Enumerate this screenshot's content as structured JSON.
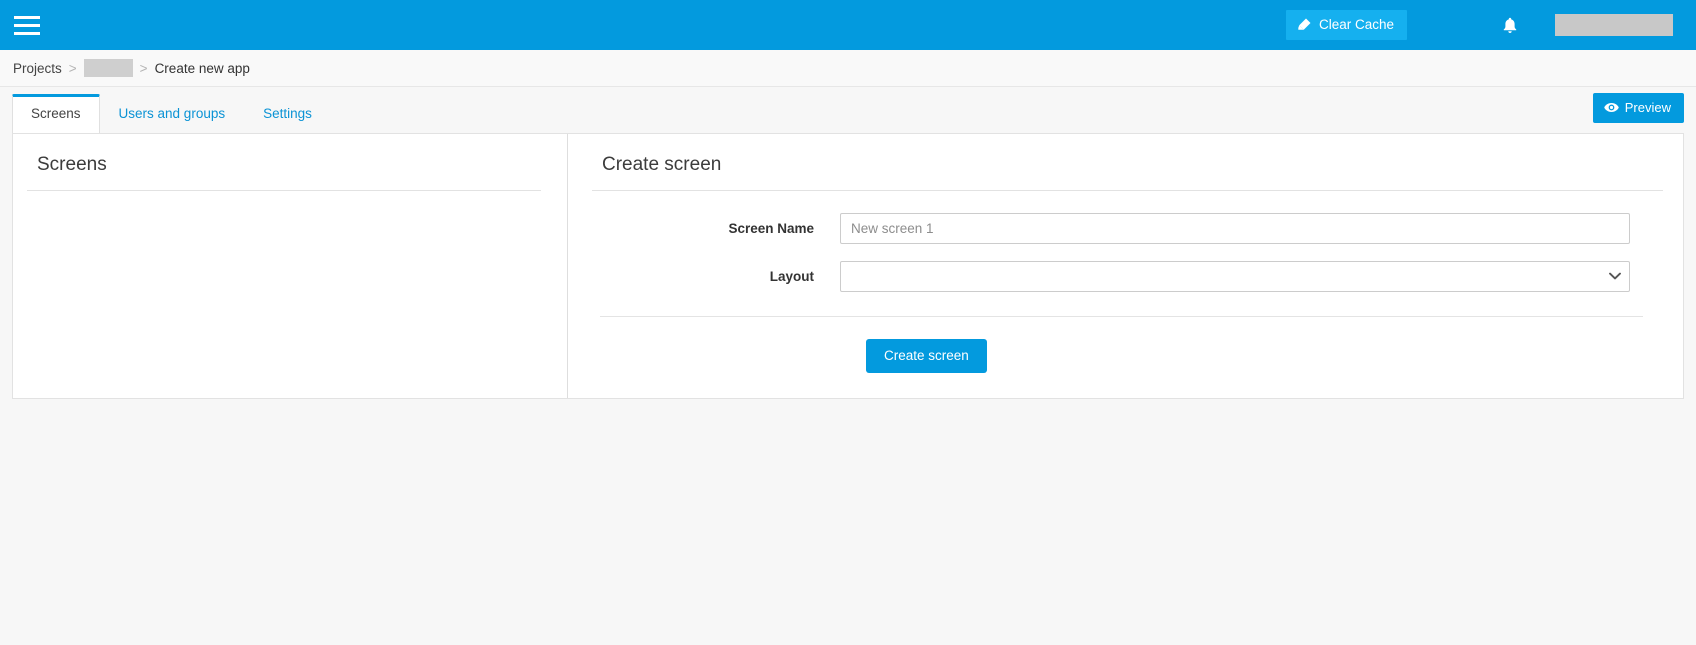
{
  "topbar": {
    "menu_icon": "hamburger-icon",
    "clear_cache_label": "Clear Cache",
    "clear_cache_icon": "eraser-icon",
    "notifications_icon": "bell-icon",
    "user_area_redacted": "",
    "bg_color": "#039ade",
    "clear_cache_color": "#15b0ef"
  },
  "breadcrumb": {
    "projects_label": "Projects",
    "separator_1": ">",
    "project_redacted": "",
    "separator_2": ">",
    "current_label": "Create new app"
  },
  "tabs": {
    "items": [
      {
        "label": "Screens",
        "active": true
      },
      {
        "label": "Users and groups",
        "active": false
      },
      {
        "label": "Settings",
        "active": false
      }
    ],
    "preview_label": "Preview",
    "preview_icon": "eye-icon"
  },
  "screens_panel": {
    "title": "Screens",
    "empty_list": []
  },
  "create_screen_panel": {
    "title": "Create screen",
    "fields": {
      "screen_name": {
        "label": "Screen Name",
        "value": "",
        "placeholder": "New screen 1"
      },
      "layout": {
        "label": "Layout",
        "value": "",
        "options": [
          ""
        ],
        "chevron_icon": "chevron-down-icon"
      }
    },
    "submit_label": "Create screen",
    "submit_color": "#039ade"
  }
}
